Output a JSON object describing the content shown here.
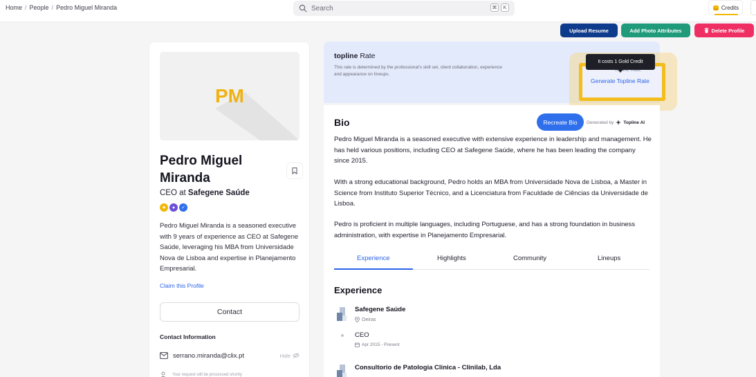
{
  "breadcrumb": {
    "items": [
      "Home",
      "People",
      "Pedro Miguel Miranda"
    ],
    "separator": "/"
  },
  "search": {
    "placeholder": "Search",
    "shortcut": [
      "⌘",
      "K"
    ]
  },
  "header": {
    "credits_label": "Credits"
  },
  "actions": {
    "upload_resume": "Upload Resume",
    "add_photo_attributes": "Add Photo Attributes",
    "delete_profile": "Delete Profile"
  },
  "profile": {
    "initials": "PM",
    "name": "Pedro Miguel Miranda",
    "role": "CEO",
    "role_connector": "at",
    "company": "Safegene Saúde",
    "summary": "Pedro Miguel Miranda is a seasoned executive with 9 years of experience as CEO at Safegene Saúde, leveraging his MBA from Universidade Nova de Lisboa and expertise in Planejamento Empresarial.",
    "claim_label": "Claim this Profile",
    "contact_label": "Contact",
    "contact_info_heading": "Contact Information",
    "email": "serrano.miranda@clix.pt",
    "hide_label": "Hide",
    "request_note": "Your request will be processed shortly"
  },
  "rate": {
    "brand": "topline",
    "title_suffix": "Rate",
    "description": "This rate is determined by the professional's skill set, client collaboration, experience and appearance on lineups.",
    "generate_label": "Generate Topline Rate",
    "hidden_text": "Topline Rate",
    "tooltip": "It costs 1 Gold Credit"
  },
  "bio": {
    "heading": "Bio",
    "recreate_label": "Recreate Bio",
    "generated_by": "Generated by",
    "generator": "Topline AI",
    "paragraphs": [
      "Pedro Miguel Miranda is a seasoned executive with extensive experience in leadership and management. He has held various positions, including CEO at Safegene Saúde, where he has been leading the company since 2015.",
      "With a strong educational background, Pedro holds an MBA from Universidade Nova de Lisboa, a Master in Science from Instituto Superior Técnico, and a Licenciatura from Faculdade de Ciências da Universidade de Lisboa.",
      "Pedro is proficient in multiple languages, including Portuguese, and has a strong foundation in business administration, with expertise in Planejamento Empresarial."
    ]
  },
  "tabs": [
    "Experience",
    "Highlights",
    "Community",
    "Lineups"
  ],
  "experience": {
    "heading": "Experience",
    "items": [
      {
        "company": "Safegene Saúde",
        "location": "Oeiras",
        "position": "CEO",
        "dates": "Apr 2015 - Present"
      },
      {
        "company": "Consultorio de Patologia Clinica - Clinilab, Lda"
      }
    ]
  },
  "colors": {
    "accent": "#2a63e8",
    "upload": "#0e3b8c",
    "photo": "#1f9a7b",
    "delete": "#ef2e63",
    "initials": "#f0b212",
    "highlight": "#f2bd1d"
  }
}
